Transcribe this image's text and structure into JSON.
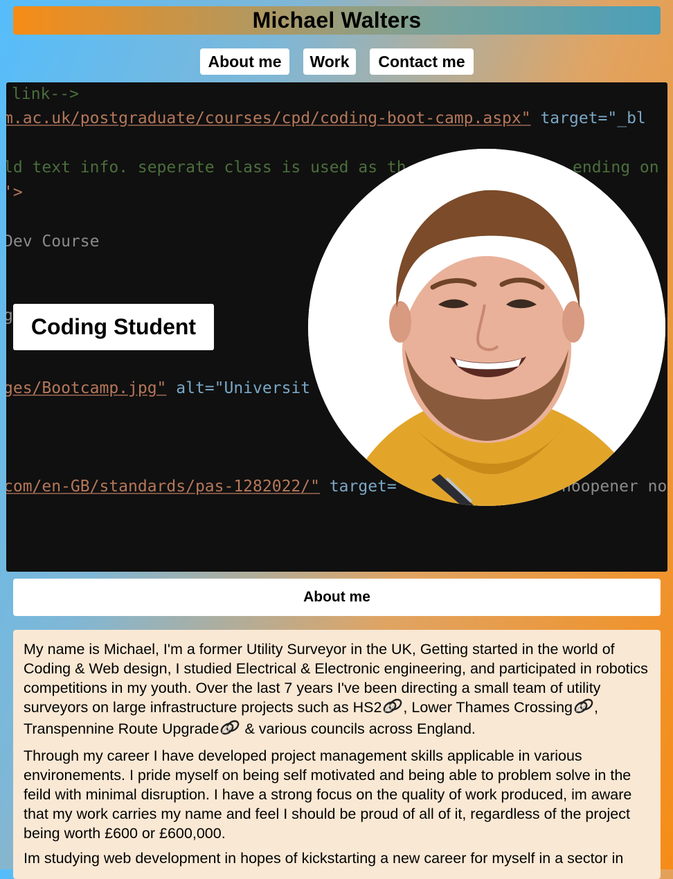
{
  "header": {
    "title": "Michael Walters"
  },
  "nav": {
    "about": "About me",
    "work": "Work",
    "contact": "Contact me"
  },
  "hero": {
    "label": "Coding Student",
    "code_lines": {
      "l1": "link-->",
      "l2_str": "m.ac.uk/postgraduate/courses/cpd/coding-boot-camp.aspx\"",
      "l2_attr": " target=\"_bl",
      "l3": "ld text info. seperate class is used as th",
      "l3b": "ending on",
      "l4": "'>",
      "l5": "Dev Course",
      "l6": "g",
      "l7_str": "ges/Bootcamp.jpg\"",
      "l7_attr": " alt=\"Universit",
      "l8_str": "com/en-GB/standards/pas-1282022/\"",
      "l8_attr": " target=",
      "l8b": "noopener nor"
    }
  },
  "about": {
    "heading": "About me",
    "p1_a": "My name is Michael, I'm a former Utility Surveyor in the UK, Getting started in the world of Coding & Web design, I studied Electrical & Electronic engineering, and participated in robotics competitions in my youth. Over the last 7 years I've been directing a small team of utility surveyors on large infrastructure projects such as HS2",
    "p1_b": ", Lower Thames Crossing",
    "p1_c": ", Transpennine Route Upgrade",
    "p1_d": " & various councils across England.",
    "p2": "Through my career I have developed project management skills applicable in various environements. I pride myself on being self motivated and being able to problem solve in the feild with minimal disruption. I have a strong focus on the quality of work produced, im aware that my work carries my name and feel I should be proud of all of it, regardless of the project being worth £600 or £600,000.",
    "p3": "Im studying web development in hopes of kickstarting a new career for myself in a sector in"
  }
}
